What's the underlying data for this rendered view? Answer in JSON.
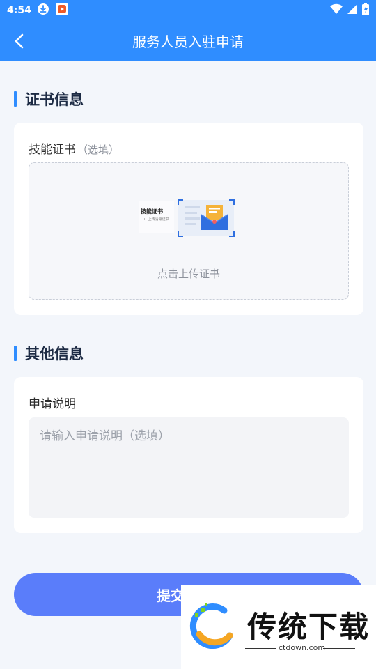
{
  "status_bar": {
    "time": "4:54"
  },
  "app_bar": {
    "title": "服务人员入驻申请"
  },
  "certificate_section": {
    "title": "证书信息",
    "field_label": "技能证书",
    "optional_tag": "（选填）",
    "upload_hint": "点击上传证书",
    "illustration_title": "技能证书",
    "illustration_subtitle": "Lu...上传清晰证书"
  },
  "other_section": {
    "title": "其他信息",
    "field_label": "申请说明",
    "placeholder": "请输入申请说明（选填）"
  },
  "submit": {
    "label": "提交"
  },
  "watermark": {
    "brand": "传统下载",
    "url": "ctdown.com"
  },
  "colors": {
    "primary": "#2f8dff",
    "button": "#5a7dfa",
    "page_bg": "#f3f6fb"
  }
}
